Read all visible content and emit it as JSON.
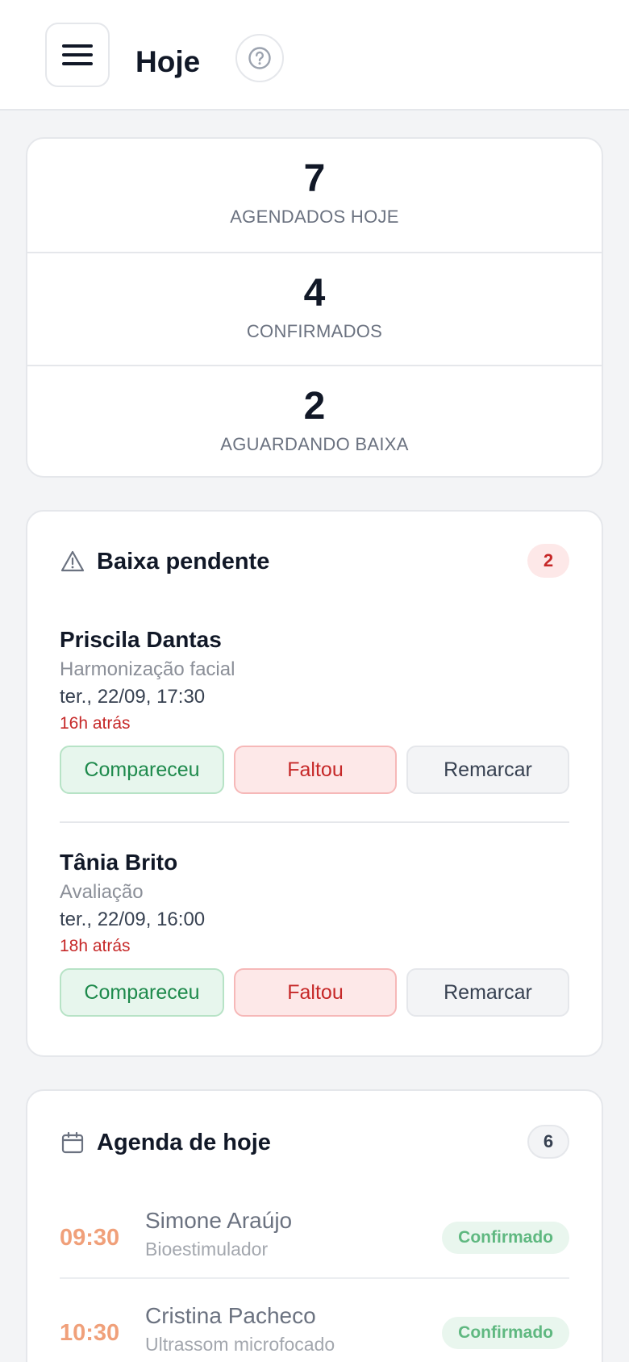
{
  "header": {
    "title": "Hoje"
  },
  "stats": [
    {
      "value": "7",
      "label": "AGENDADOS HOJE"
    },
    {
      "value": "4",
      "label": "CONFIRMADOS"
    },
    {
      "value": "2",
      "label": "AGUARDANDO BAIXA"
    }
  ],
  "pending": {
    "title": "Baixa pendente",
    "count": "2",
    "items": [
      {
        "name": "Priscila Dantas",
        "procedure": "Harmonização facial",
        "datetime": "ter., 22/09, 17:30",
        "ago": "16h atrás"
      },
      {
        "name": "Tânia Brito",
        "procedure": "Avaliação",
        "datetime": "ter., 22/09, 16:00",
        "ago": "18h atrás"
      }
    ],
    "actions": {
      "attended": "Compareceu",
      "missed": "Faltou",
      "reschedule": "Remarcar"
    }
  },
  "agenda": {
    "title": "Agenda de hoje",
    "count": "6",
    "items": [
      {
        "time": "09:30",
        "name": "Simone Araújo",
        "procedure": "Bioestimulador",
        "status": "Confirmado"
      },
      {
        "time": "10:30",
        "name": "Cristina Pacheco",
        "procedure": "Ultrassom microfocado",
        "status": "Confirmado"
      }
    ]
  },
  "icons": {
    "menu": "hamburger-icon",
    "help": "question-circle-icon",
    "pending": "warning-triangle-icon",
    "agenda": "calendar-icon"
  }
}
